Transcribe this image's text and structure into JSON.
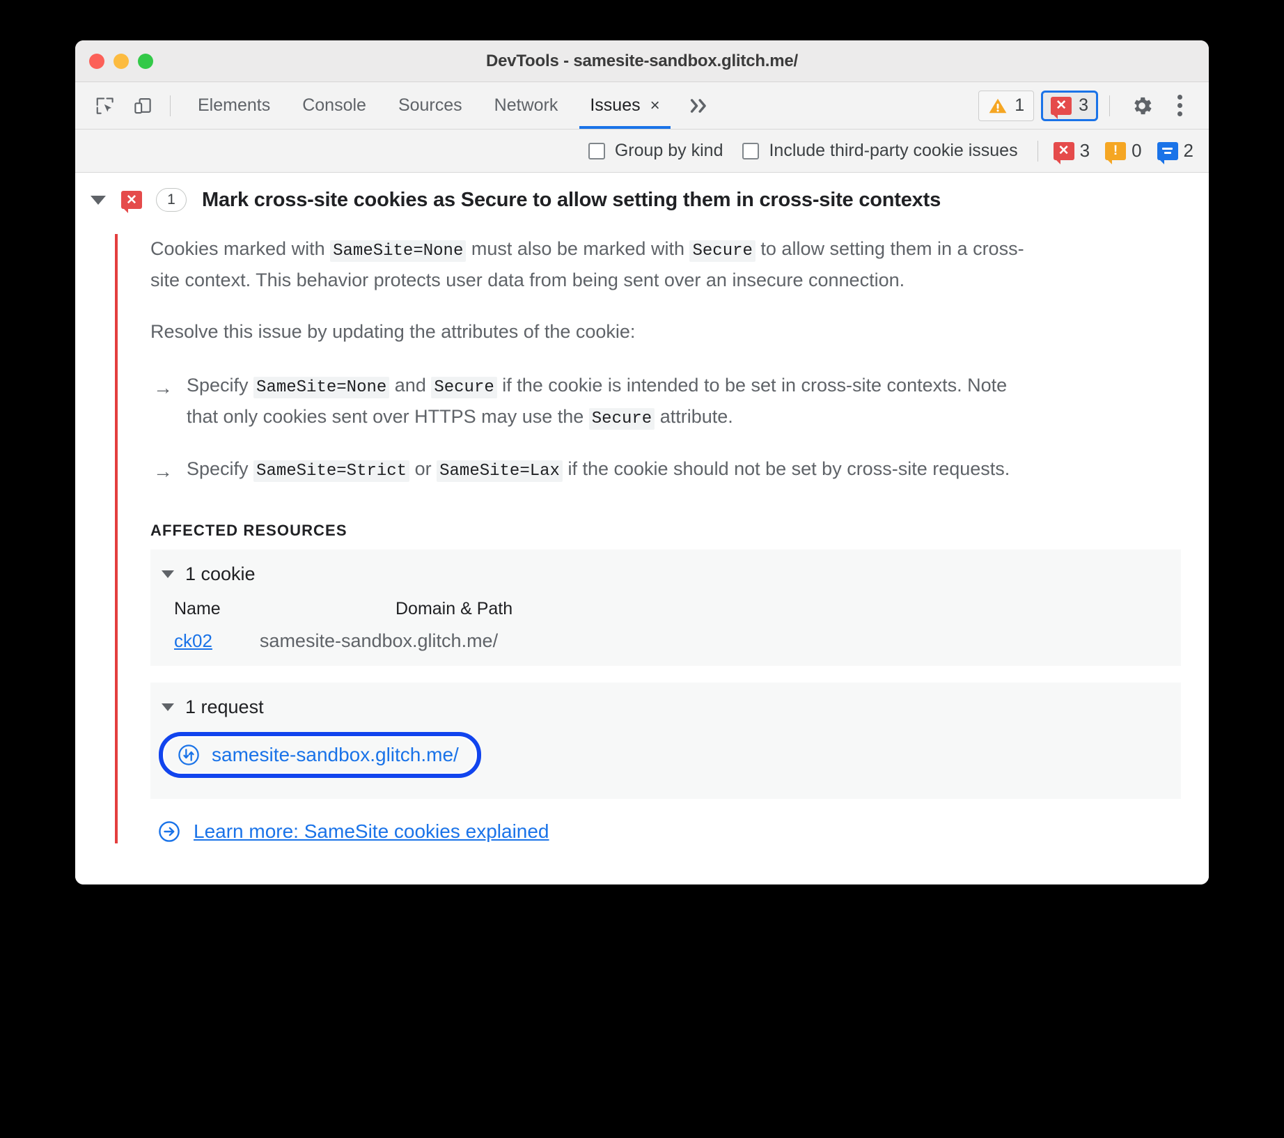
{
  "window": {
    "title": "DevTools - samesite-sandbox.glitch.me/",
    "traffic_lights": [
      "close",
      "minimize",
      "zoom"
    ]
  },
  "toolbar": {
    "inspect_icon": "inspect-element-icon",
    "device_icon": "device-toolbar-icon",
    "tabs": [
      {
        "label": "Elements",
        "active": false
      },
      {
        "label": "Console",
        "active": false
      },
      {
        "label": "Sources",
        "active": false
      },
      {
        "label": "Network",
        "active": false
      },
      {
        "label": "Issues",
        "active": true,
        "closeable": true
      }
    ],
    "close_glyph": "×",
    "more_tabs_glyph": "»",
    "warning_chip": {
      "icon": "warning-triangle-icon",
      "count": "1"
    },
    "error_chip": {
      "icon": "error-badge-icon",
      "count": "3",
      "focused": true
    },
    "settings_icon": "gear-icon",
    "menu_icon": "kebab-menu-icon"
  },
  "filterbar": {
    "group_by_kind": {
      "label": "Group by kind",
      "checked": false
    },
    "include_third_party": {
      "label": "Include third-party cookie issues",
      "checked": false
    },
    "counts": [
      {
        "kind": "error",
        "value": "3",
        "color": "#e54b4b"
      },
      {
        "kind": "warning",
        "value": "0",
        "color": "#f5a623"
      },
      {
        "kind": "info",
        "value": "2",
        "color": "#1a73e8"
      }
    ]
  },
  "issue": {
    "expanded": true,
    "severity_icon": "error-badge-icon",
    "count": "1",
    "title": "Mark cross-site cookies as Secure to allow setting them in cross-site contexts",
    "accent_color": "#e33e3e",
    "paragraphs": {
      "p1_a": "Cookies marked with ",
      "p1_code1": "SameSite=None",
      "p1_b": " must also be marked with ",
      "p1_code2": "Secure",
      "p1_c": " to allow setting them in a cross-site context. This behavior protects user data from being sent over an insecure connection.",
      "p2": "Resolve this issue by updating the attributes of the cookie:",
      "b1_arrow": "→",
      "b1_a": "Specify ",
      "b1_code1": "SameSite=None",
      "b1_b": " and ",
      "b1_code2": "Secure",
      "b1_c": " if the cookie is intended to be set in cross-site contexts. Note that only cookies sent over HTTPS may use the ",
      "b1_code3": "Secure",
      "b1_d": " attribute.",
      "b2_arrow": "→",
      "b2_a": "Specify ",
      "b2_code1": "SameSite=Strict",
      "b2_b": " or ",
      "b2_code2": "SameSite=Lax",
      "b2_c": " if the cookie should not be set by cross-site requests."
    },
    "affected_resources_label": "AFFECTED RESOURCES",
    "cookies_section": {
      "expanded": true,
      "header": "1 cookie",
      "columns": [
        "Name",
        "Domain & Path"
      ],
      "rows": [
        {
          "name": "ck02",
          "domain_path": "samesite-sandbox.glitch.me/"
        }
      ]
    },
    "requests_section": {
      "expanded": true,
      "header": "1 request",
      "rows": [
        {
          "icon": "network-request-icon",
          "url": "samesite-sandbox.glitch.me/",
          "focused": true
        }
      ]
    },
    "learn_more": {
      "icon": "arrow-in-circle-icon",
      "label": "Learn more: SameSite cookies explained"
    }
  }
}
